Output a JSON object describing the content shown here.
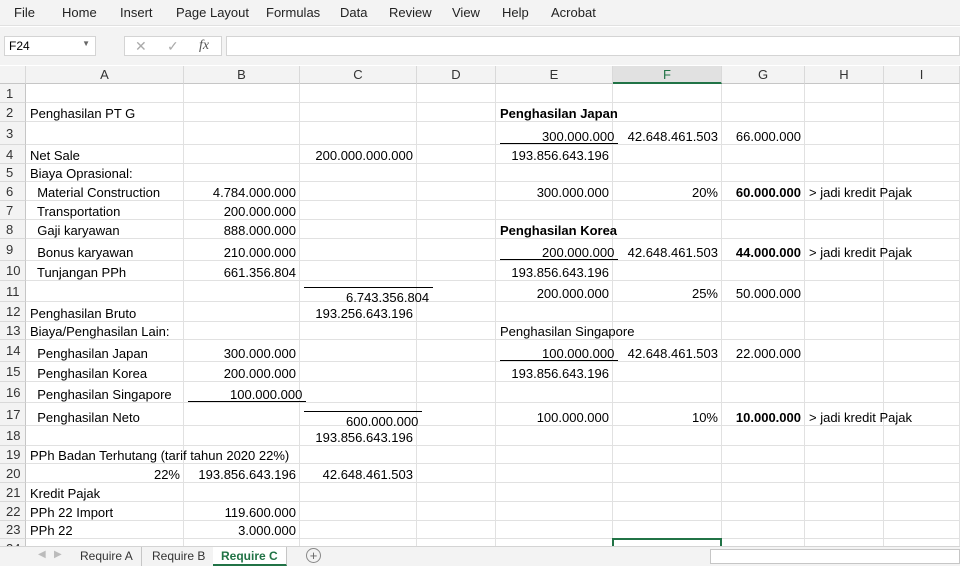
{
  "menu": [
    "File",
    "Home",
    "Insert",
    "Page Layout",
    "Formulas",
    "Data",
    "Review",
    "View",
    "Help",
    "Acrobat"
  ],
  "formula_bar": {
    "name_box": "F24",
    "cancel_icon": "✕",
    "enter_icon": "✓",
    "fx_label": "fx",
    "formula": ""
  },
  "columns": [
    "A",
    "B",
    "C",
    "D",
    "E",
    "F",
    "G",
    "H",
    "I"
  ],
  "selected_column": "F",
  "selected_cell": "F24",
  "rows": [
    {
      "n": "1",
      "cells": {}
    },
    {
      "n": "2",
      "cells": {
        "A": {
          "v": "Penghasilan PT G"
        },
        "E": {
          "v": "Penghasilan Japan",
          "b": true
        }
      }
    },
    {
      "n": "3",
      "cells": {
        "E": {
          "v": "300.000.000",
          "r": true,
          "ul": "bot"
        },
        "F": {
          "v": "42.648.461.503",
          "r": true
        },
        "G": {
          "v": "66.000.000",
          "r": true
        }
      }
    },
    {
      "n": "4",
      "cells": {
        "A": {
          "v": "Net Sale"
        },
        "C": {
          "v": "200.000.000.000",
          "r": true
        },
        "E": {
          "v": "193.856.643.196",
          "r": true
        }
      }
    },
    {
      "n": "5",
      "cells": {
        "A": {
          "v": "Biaya Oprasional:"
        }
      }
    },
    {
      "n": "6",
      "cells": {
        "A": {
          "v": "  Material Construction"
        },
        "B": {
          "v": "4.784.000.000",
          "r": true
        },
        "E": {
          "v": "300.000.000",
          "r": true
        },
        "F": {
          "v": "20%",
          "r": true
        },
        "G": {
          "v": "60.000.000",
          "r": true,
          "b": true
        },
        "H": {
          "v": "> jadi kredit Pajak"
        }
      }
    },
    {
      "n": "7",
      "cells": {
        "A": {
          "v": "  Transportation"
        },
        "B": {
          "v": "200.000.000",
          "r": true
        }
      }
    },
    {
      "n": "8",
      "cells": {
        "A": {
          "v": "  Gaji karyawan"
        },
        "B": {
          "v": "888.000.000",
          "r": true
        },
        "E": {
          "v": "Penghasilan Korea",
          "b": true
        }
      }
    },
    {
      "n": "9",
      "cells": {
        "A": {
          "v": "  Bonus karyawan"
        },
        "B": {
          "v": "210.000.000",
          "r": true
        },
        "E": {
          "v": "200.000.000",
          "r": true,
          "ul": "bot"
        },
        "F": {
          "v": "42.648.461.503",
          "r": true
        },
        "G": {
          "v": "44.000.000",
          "r": true,
          "b": true
        },
        "H": {
          "v": "> jadi kredit Pajak"
        }
      }
    },
    {
      "n": "10",
      "cells": {
        "A": {
          "v": "  Tunjangan PPh"
        },
        "B": {
          "v": "661.356.804",
          "r": true
        },
        "E": {
          "v": "193.856.643.196",
          "r": true
        }
      }
    },
    {
      "n": "11",
      "cells": {
        "C": {
          "v": "6.743.356.804",
          "r": true,
          "ul": "top"
        },
        "E": {
          "v": "200.000.000",
          "r": true
        },
        "F": {
          "v": "25%",
          "r": true
        },
        "G": {
          "v": "50.000.000",
          "r": true
        }
      }
    },
    {
      "n": "12",
      "cells": {
        "A": {
          "v": "Penghasilan Bruto"
        },
        "C": {
          "v": "193.256.643.196",
          "r": true
        }
      }
    },
    {
      "n": "13",
      "cells": {
        "A": {
          "v": "Biaya/Penghasilan Lain:"
        },
        "E": {
          "v": "Penghasilan Singapore"
        }
      }
    },
    {
      "n": "14",
      "cells": {
        "A": {
          "v": "  Penghasilan Japan"
        },
        "B": {
          "v": "300.000.000",
          "r": true
        },
        "E": {
          "v": "100.000.000",
          "r": true,
          "ul": "bot"
        },
        "F": {
          "v": "42.648.461.503",
          "r": true
        },
        "G": {
          "v": "22.000.000",
          "r": true
        }
      }
    },
    {
      "n": "15",
      "cells": {
        "A": {
          "v": "  Penghasilan Korea"
        },
        "B": {
          "v": "200.000.000",
          "r": true
        },
        "E": {
          "v": "193.856.643.196",
          "r": true
        }
      }
    },
    {
      "n": "16",
      "cells": {
        "A": {
          "v": "  Penghasilan Singapore"
        },
        "B": {
          "v": "100.000.000",
          "r": true,
          "ul": "bot"
        }
      }
    },
    {
      "n": "17",
      "cells": {
        "A": {
          "v": "  Penghasilan Neto"
        },
        "C": {
          "v": "600.000.000",
          "r": true,
          "ul": "top"
        },
        "E": {
          "v": "100.000.000",
          "r": true
        },
        "F": {
          "v": "10%",
          "r": true
        },
        "G": {
          "v": "10.000.000",
          "r": true,
          "b": true
        },
        "H": {
          "v": "> jadi kredit Pajak"
        }
      }
    },
    {
      "n": "18",
      "cells": {
        "C": {
          "v": "193.856.643.196",
          "r": true
        }
      }
    },
    {
      "n": "19",
      "cells": {
        "A": {
          "v": "PPh Badan Terhutang (tarif tahun 2020 22%)"
        }
      }
    },
    {
      "n": "20",
      "cells": {
        "A": {
          "v": "22%",
          "r": true
        },
        "B": {
          "v": "193.856.643.196",
          "r": true
        },
        "C": {
          "v": "42.648.461.503",
          "r": true
        }
      }
    },
    {
      "n": "21",
      "cells": {
        "A": {
          "v": "Kredit Pajak"
        }
      }
    },
    {
      "n": "22",
      "cells": {
        "A": {
          "v": "PPh 22 Import"
        },
        "B": {
          "v": "119.600.000",
          "r": true
        }
      }
    },
    {
      "n": "23",
      "cells": {
        "A": {
          "v": "PPh 22"
        },
        "B": {
          "v": "3.000.000",
          "r": true
        }
      }
    },
    {
      "n": "24",
      "cells": {}
    }
  ],
  "sheet_tabs": [
    {
      "label": "Require A",
      "active": false
    },
    {
      "label": "Require B",
      "active": false
    },
    {
      "label": "Require C",
      "active": true
    }
  ],
  "add_sheet_icon": "+",
  "accent_color": "#217346"
}
